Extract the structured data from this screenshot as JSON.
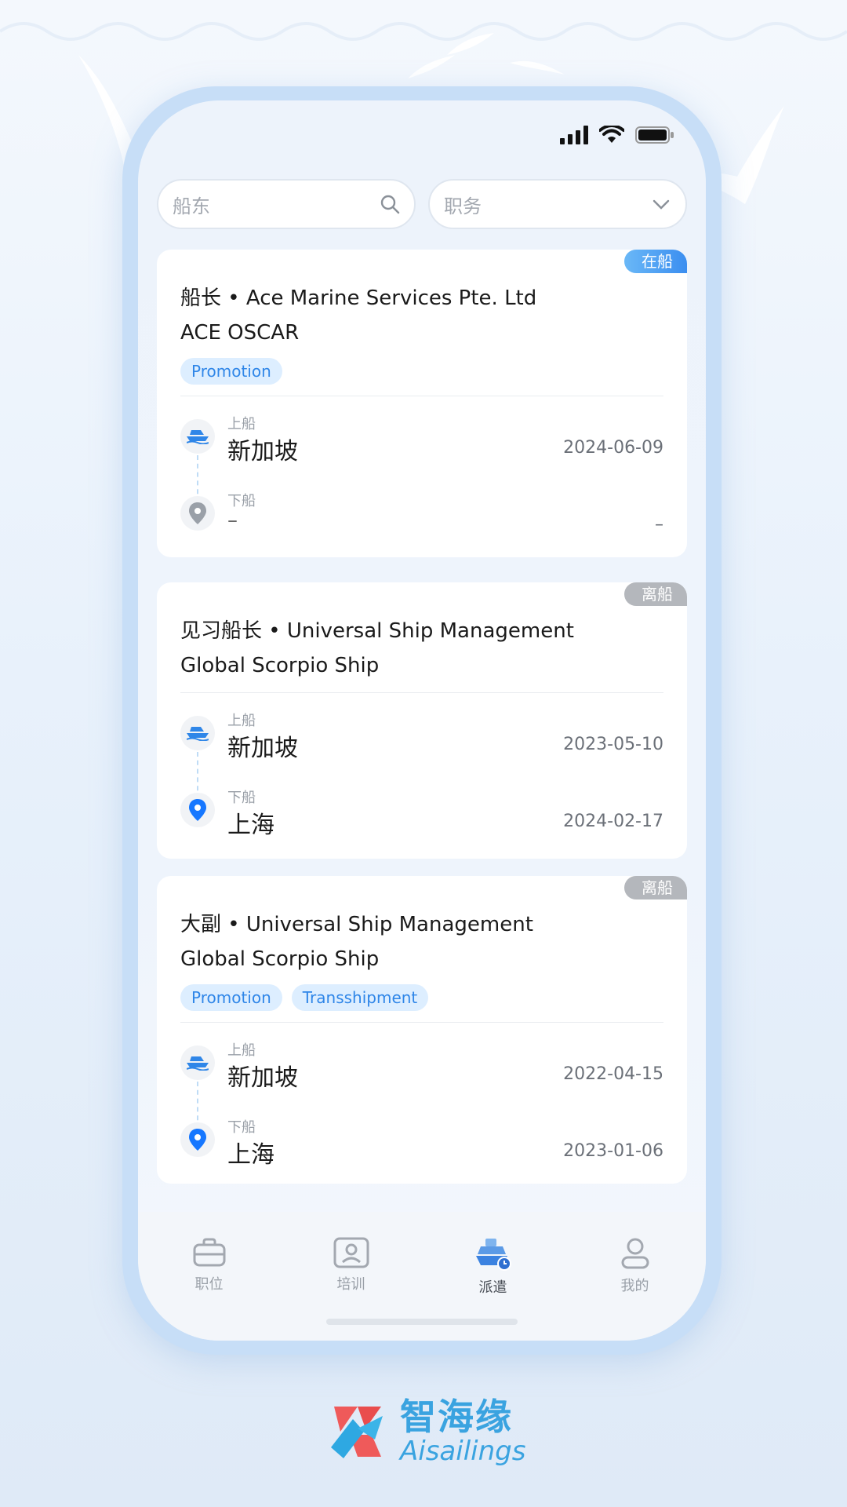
{
  "filters": {
    "owner_placeholder": "船东",
    "position_placeholder": "职务"
  },
  "colors": {
    "accent": "#3b8ef0",
    "pill_bg": "#ddeeff",
    "status_off": "#b4b7bc",
    "brand": "#3aa3e0"
  },
  "cards": [
    {
      "status": "在船",
      "title_line1": "船长 • Ace Marine Services Pte. Ltd",
      "title_line2": "ACE OSCAR",
      "tags": [
        "Promotion"
      ],
      "embark": {
        "label": "上船",
        "place": "新加坡",
        "date": "2024-06-09"
      },
      "disembark": {
        "label": "下船",
        "place": "–",
        "date": "–"
      }
    },
    {
      "status": "离船",
      "title_line1": "见习船长 • Universal Ship Management",
      "title_line2": "Global Scorpio Ship",
      "tags": [],
      "embark": {
        "label": "上船",
        "place": "新加坡",
        "date": "2023-05-10"
      },
      "disembark": {
        "label": "下船",
        "place": "上海",
        "date": "2024-02-17"
      }
    },
    {
      "status": "离船",
      "title_line1": "大副 • Universal Ship Management",
      "title_line2": "Global Scorpio Ship",
      "tags": [
        "Promotion",
        "Transshipment"
      ],
      "embark": {
        "label": "上船",
        "place": "新加坡",
        "date": "2022-04-15"
      },
      "disembark": {
        "label": "下船",
        "place": "上海",
        "date": "2023-01-06"
      }
    }
  ],
  "tabbar": [
    {
      "label": "职位",
      "icon": "briefcase-icon"
    },
    {
      "label": "培训",
      "icon": "training-icon"
    },
    {
      "label": "派遣",
      "icon": "ship-dispatch-icon",
      "active": true
    },
    {
      "label": "我的",
      "icon": "user-icon"
    }
  ],
  "brand": {
    "name_cn": "智海缘",
    "name_en": "Aisailings"
  }
}
